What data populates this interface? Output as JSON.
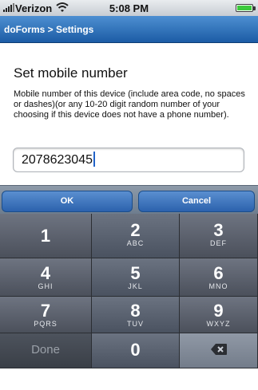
{
  "status_bar": {
    "carrier": "Verizon",
    "time": "5:08 PM",
    "signal_icon": "signal-bars-icon",
    "wifi_icon": "wifi-icon",
    "battery_icon": "battery-icon",
    "battery_color": "#3dc93d"
  },
  "nav": {
    "title": "doForms > Settings",
    "bar_color": "#1c5ca5"
  },
  "form": {
    "heading": "Set mobile number",
    "help_text": "Mobile number of this device (include area code, no spaces or dashes)(or any 10-20 digit random number of your choosing if this device does not have a phone number).",
    "input_value": "2078623045"
  },
  "actions": {
    "ok_label": "OK",
    "cancel_label": "Cancel"
  },
  "keypad": {
    "keys": [
      {
        "num": "1",
        "letters": ""
      },
      {
        "num": "2",
        "letters": "ABC"
      },
      {
        "num": "3",
        "letters": "DEF"
      },
      {
        "num": "4",
        "letters": "GHI"
      },
      {
        "num": "5",
        "letters": "JKL"
      },
      {
        "num": "6",
        "letters": "MNO"
      },
      {
        "num": "7",
        "letters": "PQRS"
      },
      {
        "num": "8",
        "letters": "TUV"
      },
      {
        "num": "9",
        "letters": "WXYZ"
      },
      {
        "num": "0",
        "letters": ""
      }
    ],
    "done_label": "Done",
    "delete_icon": "backspace-icon"
  }
}
